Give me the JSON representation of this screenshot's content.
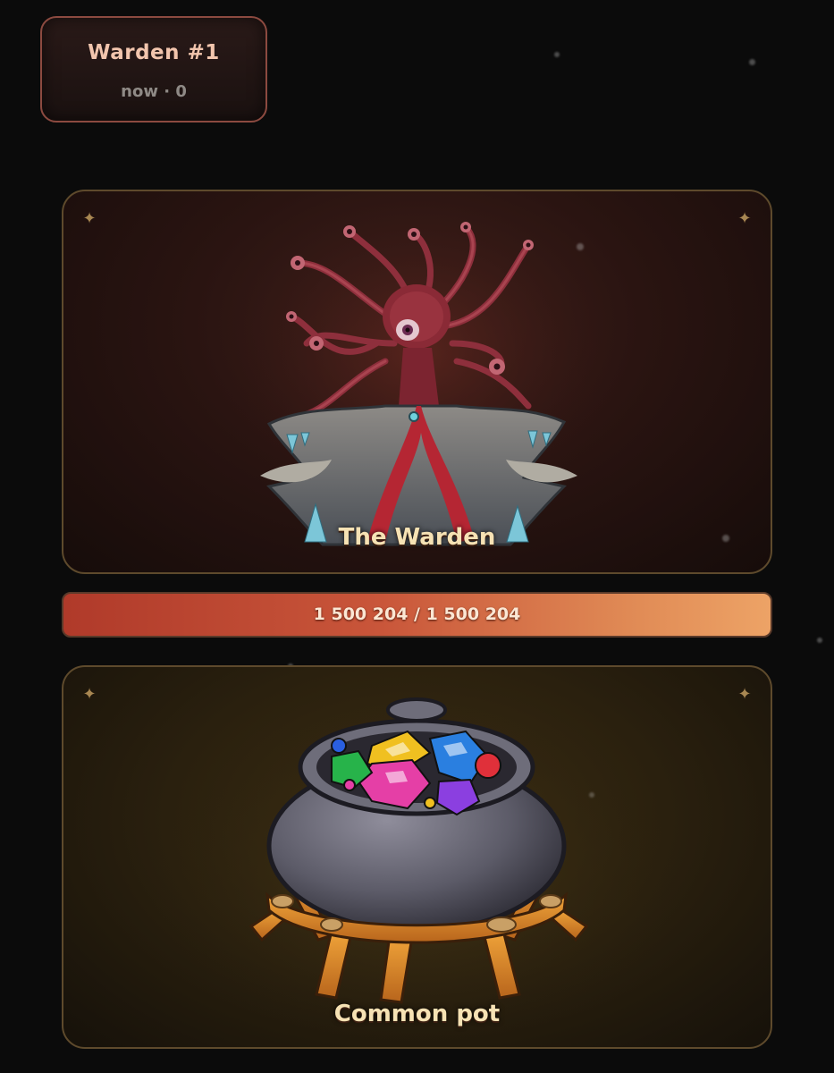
{
  "header": {
    "title": "Warden #1",
    "subtitle": "now · 0"
  },
  "boss": {
    "name": "The Warden",
    "portrait": "warden-tentacle-creature-illustration"
  },
  "health": {
    "label": "1 500 204 / 1 500 204",
    "current": 1500204,
    "max": 1500204,
    "fraction": 1.0
  },
  "reward": {
    "name": "Common pot",
    "image": "cauldron-of-gems-illustration"
  },
  "icons": {
    "corner": "four-point-sparkle-icon"
  },
  "colors": {
    "accent": "#f2c5ad",
    "label": "#f6e2b4",
    "hp_start": "#b03a2a",
    "hp_end": "#eda366",
    "panel_border": "#5e4a2c"
  }
}
